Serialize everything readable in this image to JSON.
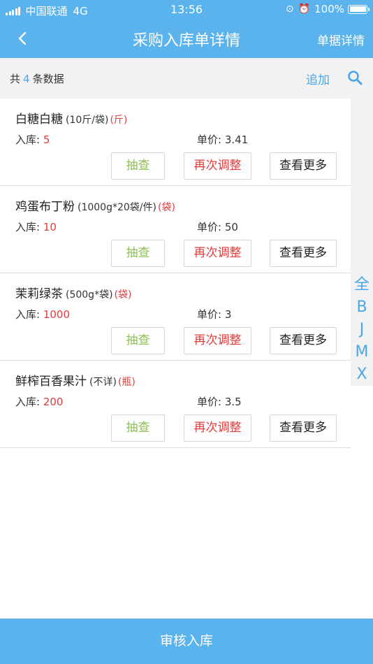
{
  "status_bar": {
    "carrier": "中国联通",
    "network": "4G",
    "time": "13:56",
    "battery": "100%"
  },
  "nav": {
    "title": "采购入库单详情",
    "right_label": "单据详情"
  },
  "summary": {
    "prefix": "共",
    "count": "4",
    "suffix": "条数据",
    "add_label": "追加"
  },
  "items": [
    {
      "name": "白糖白糖",
      "spec": "(10斤/袋)",
      "unit": "(斤)",
      "qty_label": "入库: ",
      "qty": "5",
      "price_label": "单价: ",
      "price": "3.41"
    },
    {
      "name": "鸡蛋布丁粉",
      "spec": "(1000g*20袋/件)",
      "unit": "(袋)",
      "qty_label": "入库: ",
      "qty": "10",
      "price_label": "单价: ",
      "price": "50"
    },
    {
      "name": "茉莉绿茶",
      "spec": "(500g*袋)",
      "unit": "(袋)",
      "qty_label": "入库: ",
      "qty": "1000",
      "price_label": "单价: ",
      "price": "3"
    },
    {
      "name": "鲜榨百香果汁",
      "spec": "(不详)",
      "unit": "(瓶)",
      "qty_label": "入库: ",
      "qty": "200",
      "price_label": "单价: ",
      "price": "3.5"
    }
  ],
  "buttons": {
    "check": "抽查",
    "adjust": "再次调整",
    "more": "查看更多"
  },
  "index_letters": [
    "全",
    "B",
    "J",
    "M",
    "X"
  ],
  "footer": {
    "submit_label": "审核入库"
  },
  "colors": {
    "primary": "#5ab3ec",
    "accent_blue": "#4aa7e6",
    "red": "#e03c3c",
    "green": "#8cc152"
  }
}
